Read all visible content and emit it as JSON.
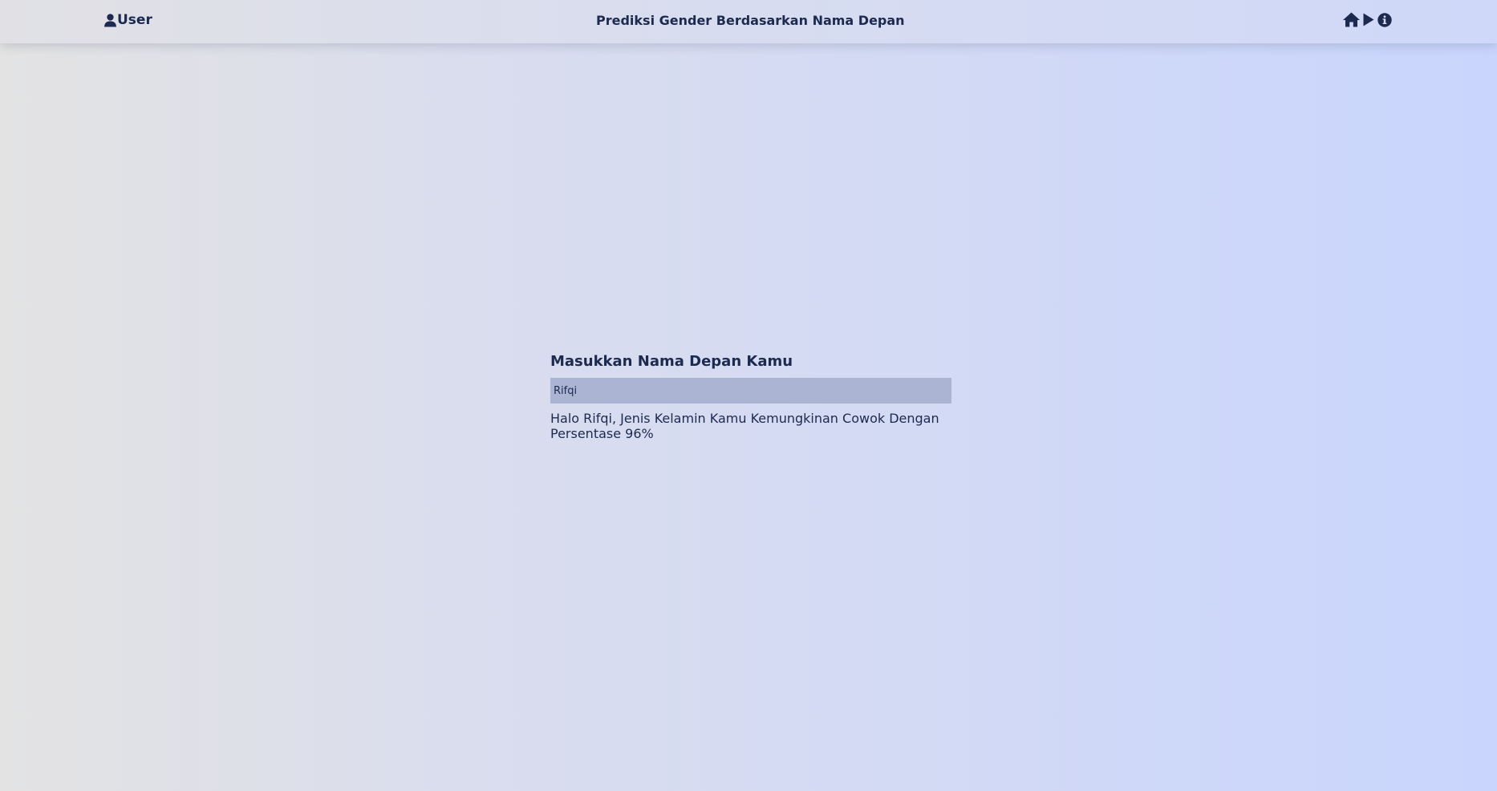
{
  "header": {
    "user_label": "User",
    "title": "Prediksi Gender Berdasarkan Nama Depan",
    "icons": [
      "user-icon",
      "home-icon",
      "play-icon",
      "info-icon"
    ]
  },
  "form": {
    "label": "Masukkan Nama Depan Kamu",
    "name_value": "Rifqi",
    "result": "Halo Rifqi, Jenis Kelamin Kamu Kemungkinan Cowok Dengan Persentase 96%"
  },
  "colors": {
    "text": "#1c2a4f",
    "input_background": "#abb4d2",
    "gradient_left": "#e3e3e3",
    "gradient_right": "#c9d5fd"
  }
}
